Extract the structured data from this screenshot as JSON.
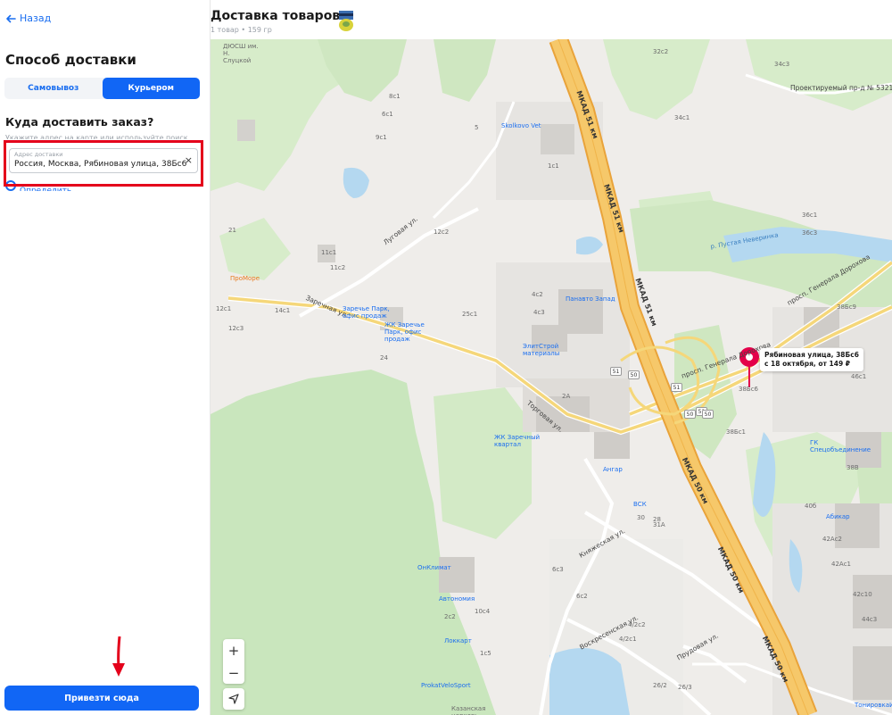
{
  "left_panel": {
    "back_label": "Назад",
    "delivery_heading": "Способ доставки",
    "tabs": [
      {
        "label": "Самовывоз",
        "active": false
      },
      {
        "label": "Курьером",
        "active": true
      }
    ],
    "where_heading": "Куда доставить заказ?",
    "hint": "Укажите адрес на карте или используйте поиск",
    "address": {
      "label": "Адрес доставки",
      "value": "Россия, Москва, Рябиновая улица, 38Бс6",
      "clear": "×"
    },
    "geo_label": "Определить местоположение",
    "submit_label": "Привезти сюда"
  },
  "header": {
    "title": "Доставка товаров",
    "subtitle": "1 товар • 159 гр"
  },
  "map": {
    "pin": {
      "line1": "Рябиновая улица, 38Бс6",
      "line2": "с 18 октября, от 149 ₽"
    },
    "zoom_in": "+",
    "zoom_out": "−",
    "roads": {
      "mkad1": "МКАД 51 км",
      "mkad2": "МКАД 51 км",
      "mkad3": "МКАД 51 км",
      "mkad4": "МКАД 50 км",
      "mkad5": "МКАД 50 км",
      "mkad6": "МКАД 50 км",
      "zarechnaya": "Заречная ул.",
      "lugovaya": "Луговая ул.",
      "torgovaya": "Торговая ул.",
      "dorokhova1": "просп. Генерала Дорохова",
      "dorokhova2": "просп. Генерала Дорохова",
      "proezd": "Проектируемый пр-д № 5321",
      "knyazhe": "Княжеская ул.",
      "voskr": "Воскресенская ул.",
      "prudovaya": "Прудовая ул.",
      "nakhodka": "р. Пустая Неверинка"
    },
    "pois": {
      "skolkovo": "Skolkovo Vet",
      "promore": "ПроМоре",
      "zarechye1": "Заречье Парк, офис продаж",
      "zarechye2": "ЖК Заречье Парк, офис продаж",
      "panaveto": "Панавто Запад",
      "elitstroy": "ЭлитСтрой материалы",
      "zhk": "ЖК Заречный квартал",
      "angar": "Ангар",
      "vsk": "ВСК",
      "onklimat": "ОнКлимат",
      "avtonomia": "Автономия",
      "lokkart": "Локкарт",
      "prokat": "ProkatVeloSport",
      "kazanskaya": "Казанская церковь",
      "abikar": "Абикар",
      "gk": "ГК Спецобъединение",
      "tonirovka": "ТонировкаИнк",
      "dyussh": "ДЮСШ им. Н. Слуцкой"
    },
    "buildings": [
      "8с1",
      "6с1",
      "9с1",
      "5",
      "1с1",
      "32с2",
      "34с3",
      "34с1",
      "36с3",
      "36с1",
      "38Бс9",
      "38Бс6",
      "38Бс1",
      "38В",
      "40б",
      "42Ас2",
      "42Ас1",
      "42с10",
      "44с3",
      "46с1",
      "4с2",
      "4с3",
      "2А",
      "25с1",
      "24",
      "12с1",
      "12с3",
      "14с1",
      "11с2",
      "11с1",
      "12с2",
      "21",
      "30",
      "28",
      "31А",
      "6с3",
      "2с2",
      "10с4",
      "1с5",
      "4/2с2",
      "4/2с1",
      "6с2",
      "26/2",
      "26/3"
    ],
    "shields": [
      "51",
      "50",
      "51",
      "51",
      "50",
      "50"
    ]
  }
}
